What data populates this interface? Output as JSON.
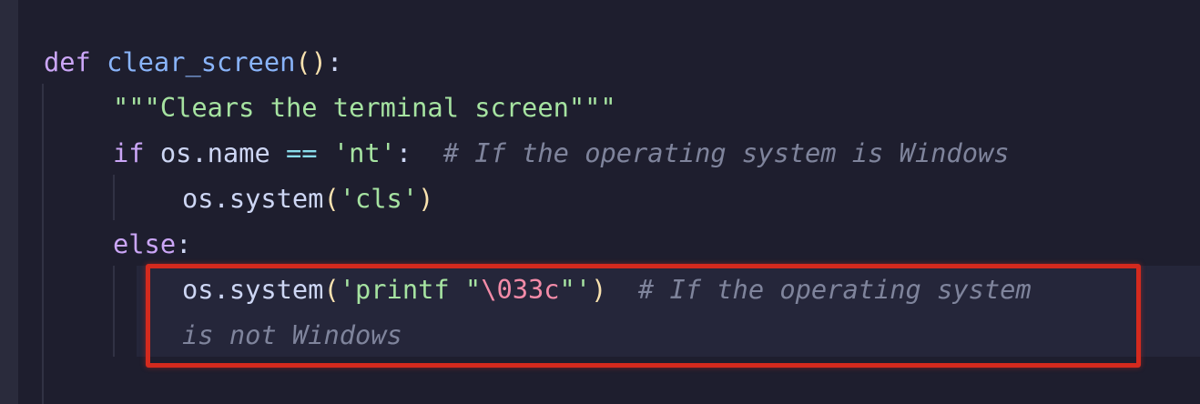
{
  "editor": {
    "lines": [
      {
        "def_kw": "def",
        "fn_name": "clear_screen",
        "open": "(",
        "close": ")",
        "colon": ":"
      },
      {
        "docstring": "\"\"\"Clears the terminal screen\"\"\""
      },
      {
        "if_kw": "if",
        "cond": "os.name ",
        "op": "==",
        "str": "'nt'",
        "colon": ":",
        "comment": "# If the operating system is Windows"
      },
      {
        "call": "os.system",
        "open": "(",
        "str": "'cls'",
        "close": ")"
      },
      {
        "else_kw": "else",
        "colon": ":"
      },
      {
        "call": "os.system",
        "open": "(",
        "str_a": "'printf \"",
        "esc": "\\033c",
        "str_b": "\"'",
        "close": ")",
        "comment": "# If the operating system"
      },
      {
        "comment": "is not Windows"
      }
    ],
    "colors": {
      "background": "#1e1e2e",
      "keyword": "#cba6f7",
      "function": "#89b4fa",
      "string": "#a6e3a1",
      "escape": "#f38ba8",
      "comment": "#7f849c",
      "highlight_border": "#d42a1e"
    }
  }
}
